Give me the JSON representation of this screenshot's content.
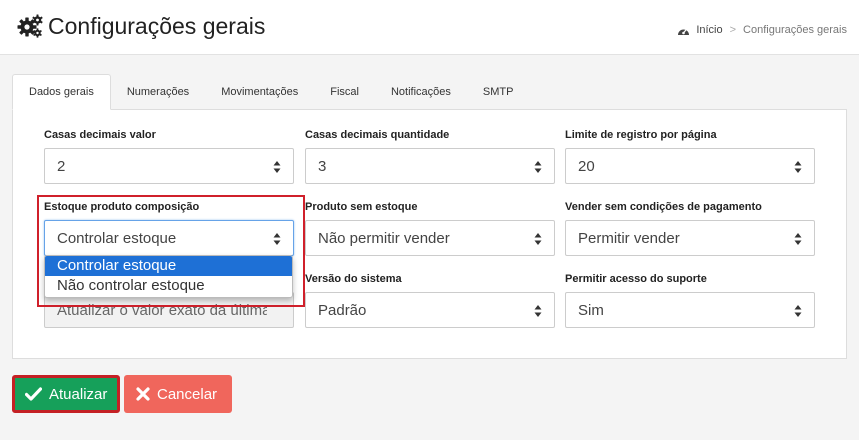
{
  "header": {
    "title": "Configurações gerais",
    "breadcrumb": {
      "home": "Início",
      "separator": ">",
      "current": "Configurações gerais"
    }
  },
  "tabs": [
    {
      "label": "Dados gerais",
      "active": true
    },
    {
      "label": "Numerações"
    },
    {
      "label": "Movimentações"
    },
    {
      "label": "Fiscal"
    },
    {
      "label": "Notificações"
    },
    {
      "label": "SMTP"
    }
  ],
  "fields": {
    "casas_decimais_valor": {
      "label": "Casas decimais valor",
      "value": "2"
    },
    "casas_decimais_quantidade": {
      "label": "Casas decimais quantidade",
      "value": "3"
    },
    "limite_registro": {
      "label": "Limite de registro por página",
      "value": "20"
    },
    "estoque_composicao": {
      "label": "Estoque produto composição",
      "value": "Controlar estoque"
    },
    "produto_sem_estoque": {
      "label": "Produto sem estoque",
      "value": "Não permitir vender"
    },
    "vender_sem_condicoes": {
      "label": "Vender sem condições de pagamento",
      "value": "Permitir vender"
    },
    "atualizar_valor": {
      "value": "Atualizar o valor exato da última"
    },
    "versao_sistema": {
      "label": "Versão do sistema",
      "value": "Padrão"
    },
    "acesso_suporte": {
      "label": "Permitir acesso do suporte",
      "value": "Sim"
    }
  },
  "dropdown": {
    "options": [
      "Controlar estoque",
      "Não controlar estoque"
    ],
    "selected_index": 0
  },
  "actions": {
    "update": "Atualizar",
    "cancel": "Cancelar"
  },
  "colors": {
    "update_button": "#16a05a",
    "cancel_button": "#f0665c",
    "highlight": "#d0202b",
    "dropdown_selected": "#1e70d6"
  }
}
